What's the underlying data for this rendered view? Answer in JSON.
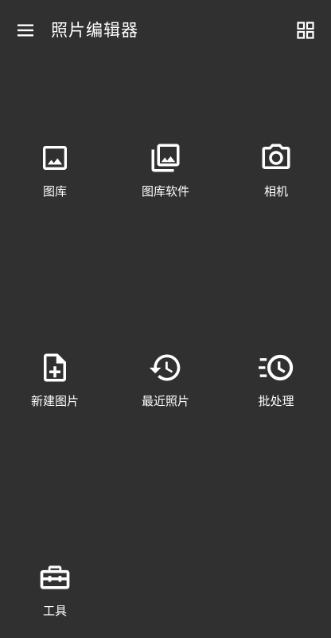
{
  "toolbar": {
    "title": "照片编辑器",
    "menu_icon": "menu-icon",
    "view_icon": "grid-view-icon"
  },
  "tiles": [
    {
      "label": "图库",
      "icon": "image-icon"
    },
    {
      "label": "图库软件",
      "icon": "photo-library-icon"
    },
    {
      "label": "相机",
      "icon": "camera-icon"
    },
    {
      "label": "新建图片",
      "icon": "note-add-icon"
    },
    {
      "label": "最近照片",
      "icon": "history-icon"
    },
    {
      "label": "批处理",
      "icon": "batch-clock-icon"
    },
    {
      "label": "工具",
      "icon": "toolbox-icon"
    }
  ],
  "colors": {
    "background": "#303030",
    "foreground": "#ffffff"
  }
}
